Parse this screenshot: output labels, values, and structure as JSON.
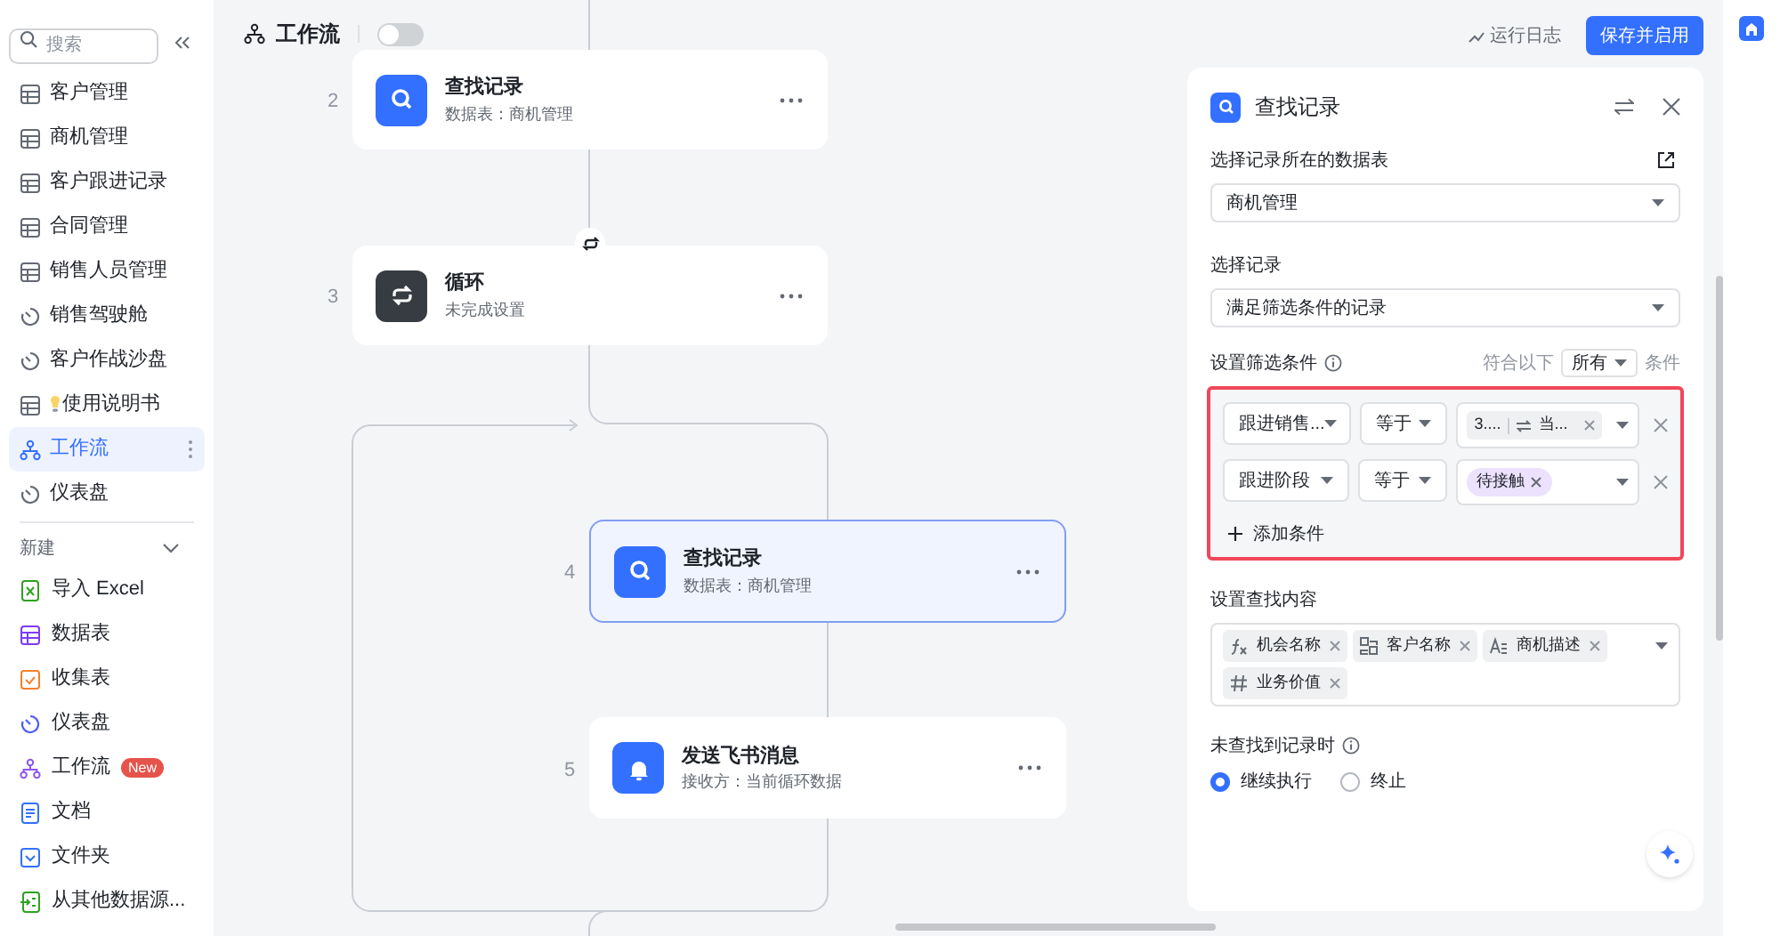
{
  "sidebar": {
    "search": {
      "placeholder": "搜索"
    },
    "items": [
      {
        "label": "客户管理",
        "kind": "table",
        "selected": false
      },
      {
        "label": "商机管理",
        "kind": "table",
        "selected": false
      },
      {
        "label": "客户跟进记录",
        "kind": "table",
        "selected": false
      },
      {
        "label": "合同管理",
        "kind": "table",
        "selected": false
      },
      {
        "label": "销售人员管理",
        "kind": "table",
        "selected": false
      },
      {
        "label": "销售驾驶舱",
        "kind": "dashboard",
        "selected": false
      },
      {
        "label": "客户作战沙盘",
        "kind": "dashboard",
        "selected": false
      },
      {
        "label": "使用说明书",
        "kind": "guide",
        "selected": false
      },
      {
        "label": "工作流",
        "kind": "workflow",
        "selected": true
      },
      {
        "label": "仪表盘",
        "kind": "dashboard",
        "selected": false
      }
    ],
    "section": {
      "title": "新建",
      "expanded": true
    },
    "new_items": [
      {
        "label": "导入 Excel",
        "kind": "excel"
      },
      {
        "label": "数据表",
        "kind": "table"
      },
      {
        "label": "收集表",
        "kind": "form"
      },
      {
        "label": "仪表盘",
        "kind": "dashboard"
      },
      {
        "label": "工作流",
        "kind": "workflow",
        "badge": "New"
      },
      {
        "label": "文档",
        "kind": "doc"
      },
      {
        "label": "文件夹",
        "kind": "folder"
      },
      {
        "label": "从其他数据源...",
        "kind": "source"
      }
    ]
  },
  "toolbar": {
    "title": "工作流",
    "toggle": {
      "on": false
    },
    "log_link": "运行日志",
    "save_button": "保存并启用"
  },
  "canvas": {
    "nodes": [
      {
        "number": "2",
        "title": "查找记录",
        "subtitle": "数据表：商机管理",
        "kind": "search",
        "selected": false
      },
      {
        "number": "3",
        "title": "循环",
        "subtitle": "未完成设置",
        "kind": "loop",
        "selected": false
      },
      {
        "number": "4",
        "title": "查找记录",
        "subtitle": "数据表：商机管理",
        "kind": "search",
        "selected": true
      },
      {
        "number": "5",
        "title": "发送飞书消息",
        "subtitle": "接收方：当前循环数据",
        "kind": "bell",
        "selected": false
      }
    ]
  },
  "panel": {
    "title": "查找记录",
    "table_label": "选择记录所在的数据表",
    "table_value": "商机管理",
    "record_label": "选择记录",
    "record_value": "满足筛选条件的记录",
    "filter_label": "设置筛选条件",
    "match_prefix": "符合以下",
    "match_value": "所有",
    "match_suffix": "条件",
    "conditions": [
      {
        "field": "跟进销售...",
        "operator": "等于",
        "values": [
          {
            "kind": "reference",
            "text": "3....",
            "extra": "当..."
          }
        ]
      },
      {
        "field": "跟进阶段",
        "operator": "等于",
        "values": [
          {
            "kind": "option",
            "text": "待接触"
          }
        ]
      }
    ],
    "add_condition": "添加条件",
    "content_label": "设置查找内容",
    "fields": [
      {
        "label": "机会名称",
        "kind": "formula"
      },
      {
        "label": "客户名称",
        "kind": "lookup"
      },
      {
        "label": "商机描述",
        "kind": "text"
      },
      {
        "label": "业务价值",
        "kind": "number"
      }
    ],
    "not_found_label": "未查找到记录时",
    "options": [
      {
        "label": "继续执行",
        "selected": true
      },
      {
        "label": "终止",
        "selected": false
      }
    ]
  }
}
